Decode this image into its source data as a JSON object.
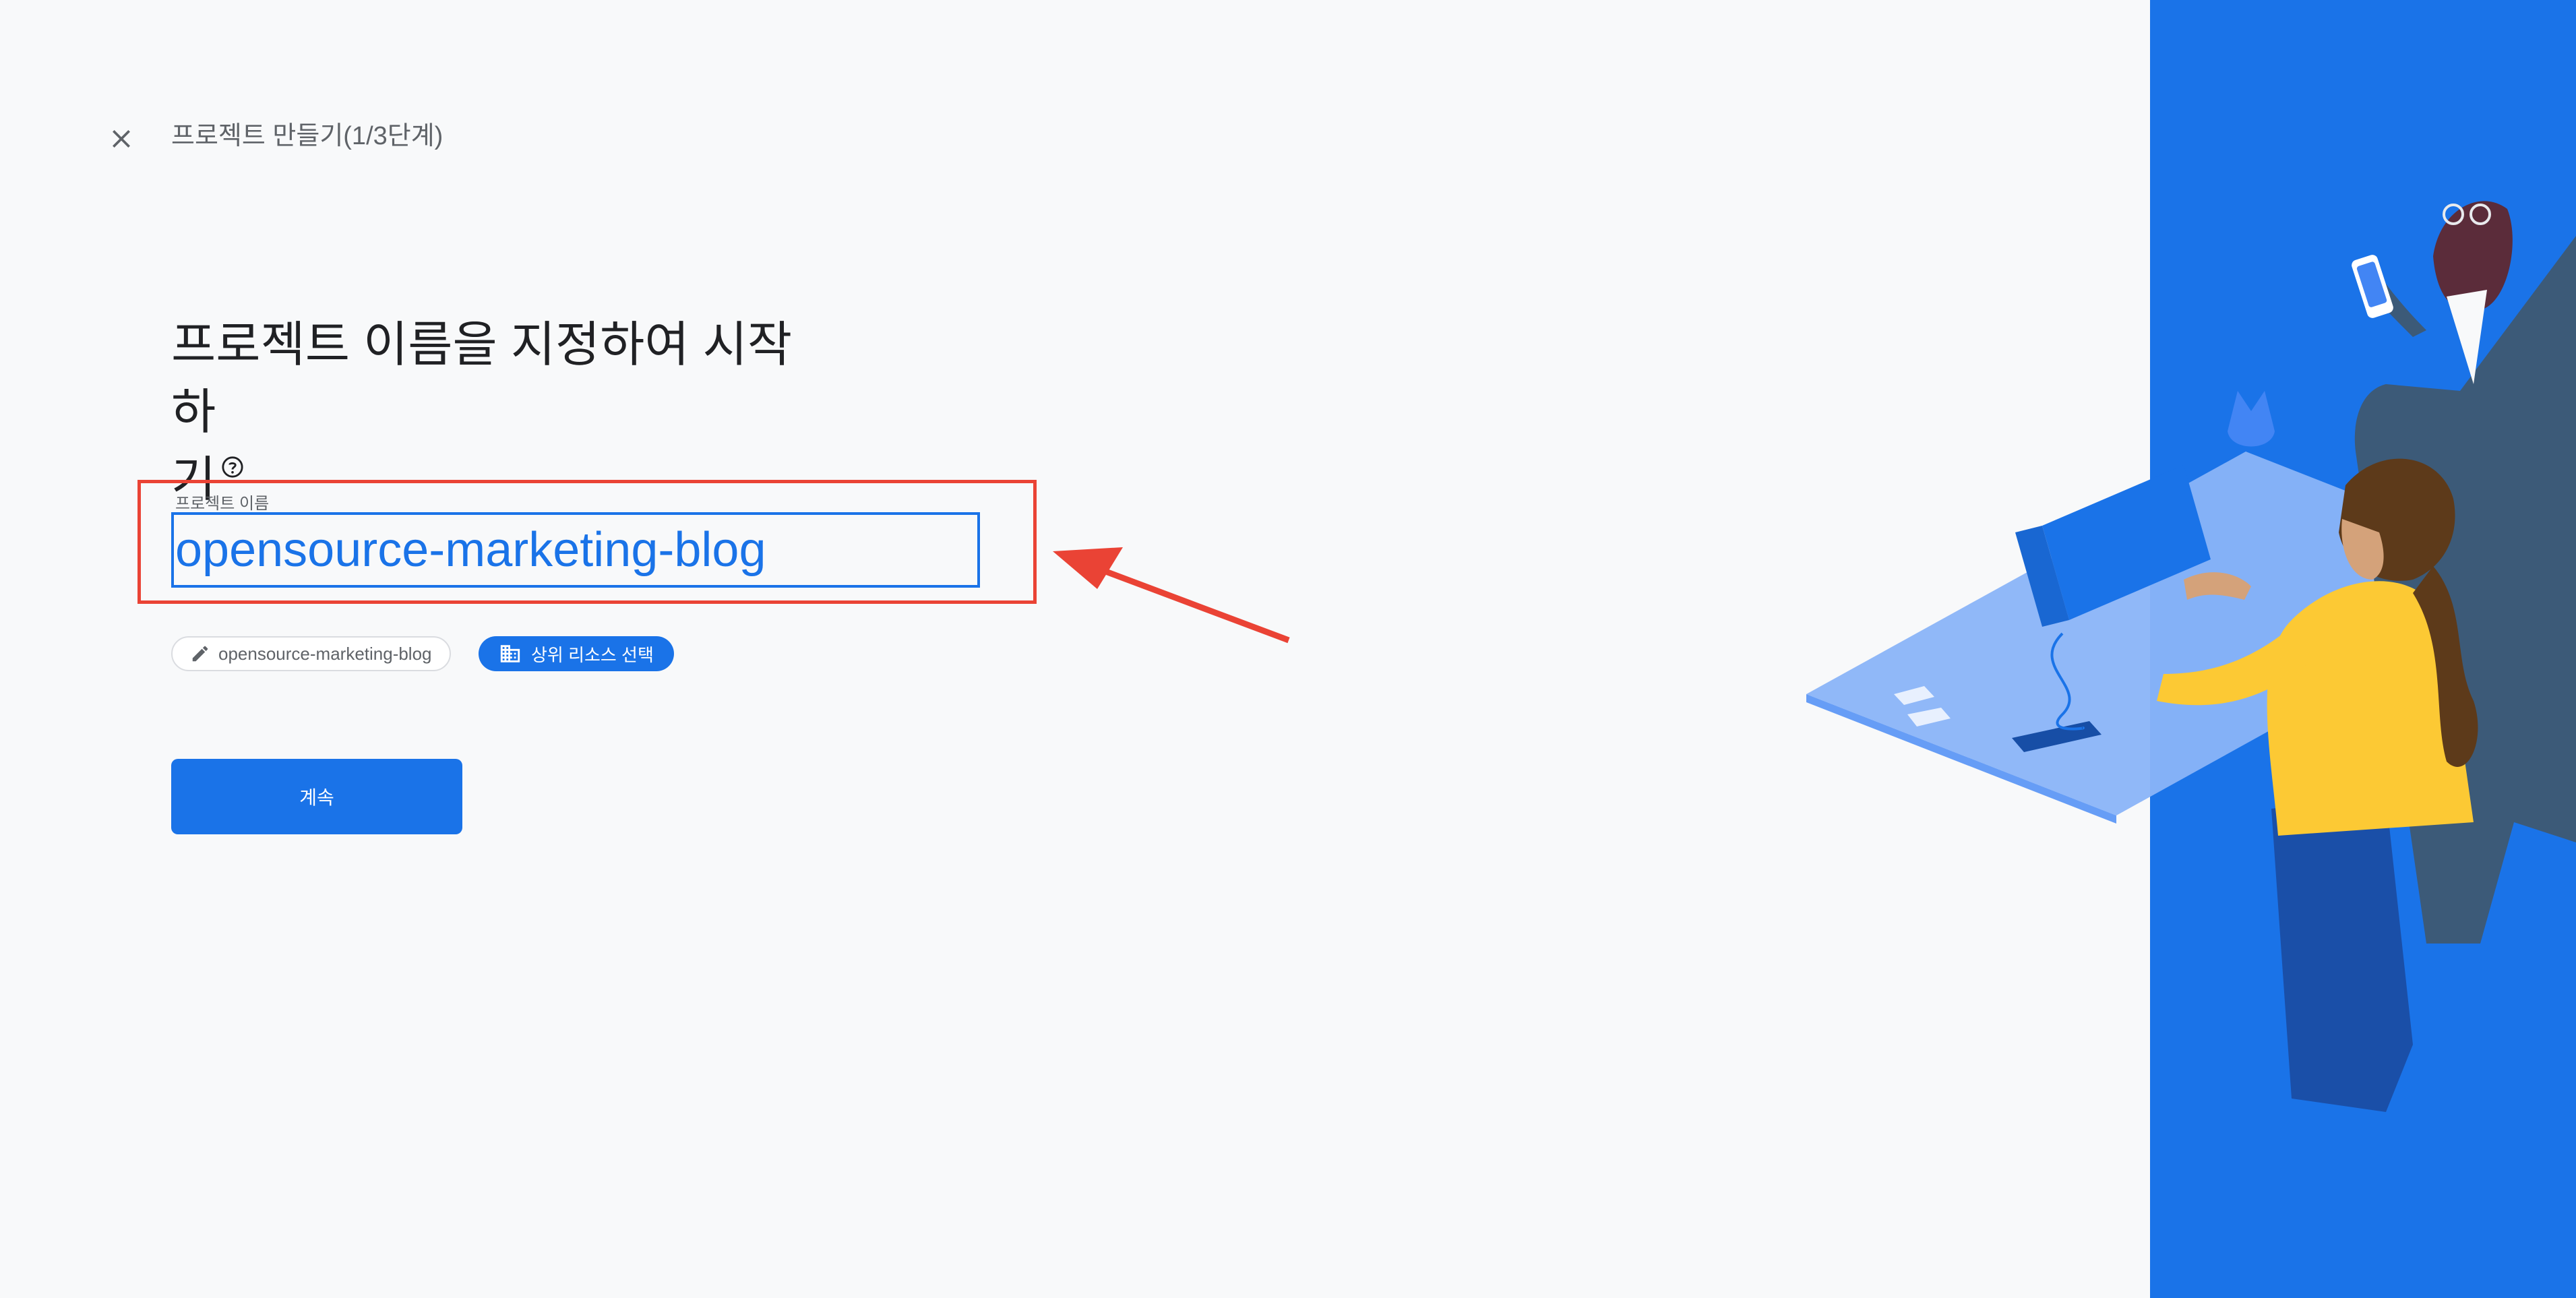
{
  "header": {
    "title": "프로젝트 만들기(1/3단계)"
  },
  "heading": {
    "line1": "프로젝트 이름을 지정하여 시작하",
    "line2": "기"
  },
  "project_name_field": {
    "label": "프로젝트 이름",
    "value": "opensource-marketing-blog"
  },
  "chips": {
    "project_id": "opensource-marketing-blog",
    "parent_resource": "상위 리소스 선택"
  },
  "continue_button": {
    "label": "계속"
  },
  "icons": {
    "close": "close-icon",
    "help": "help-circle-icon",
    "edit": "pencil-icon",
    "parent": "building-icon"
  },
  "colors": {
    "accent": "#1a73e8",
    "annotation": "#ea4335",
    "background": "#f8f9fa"
  }
}
